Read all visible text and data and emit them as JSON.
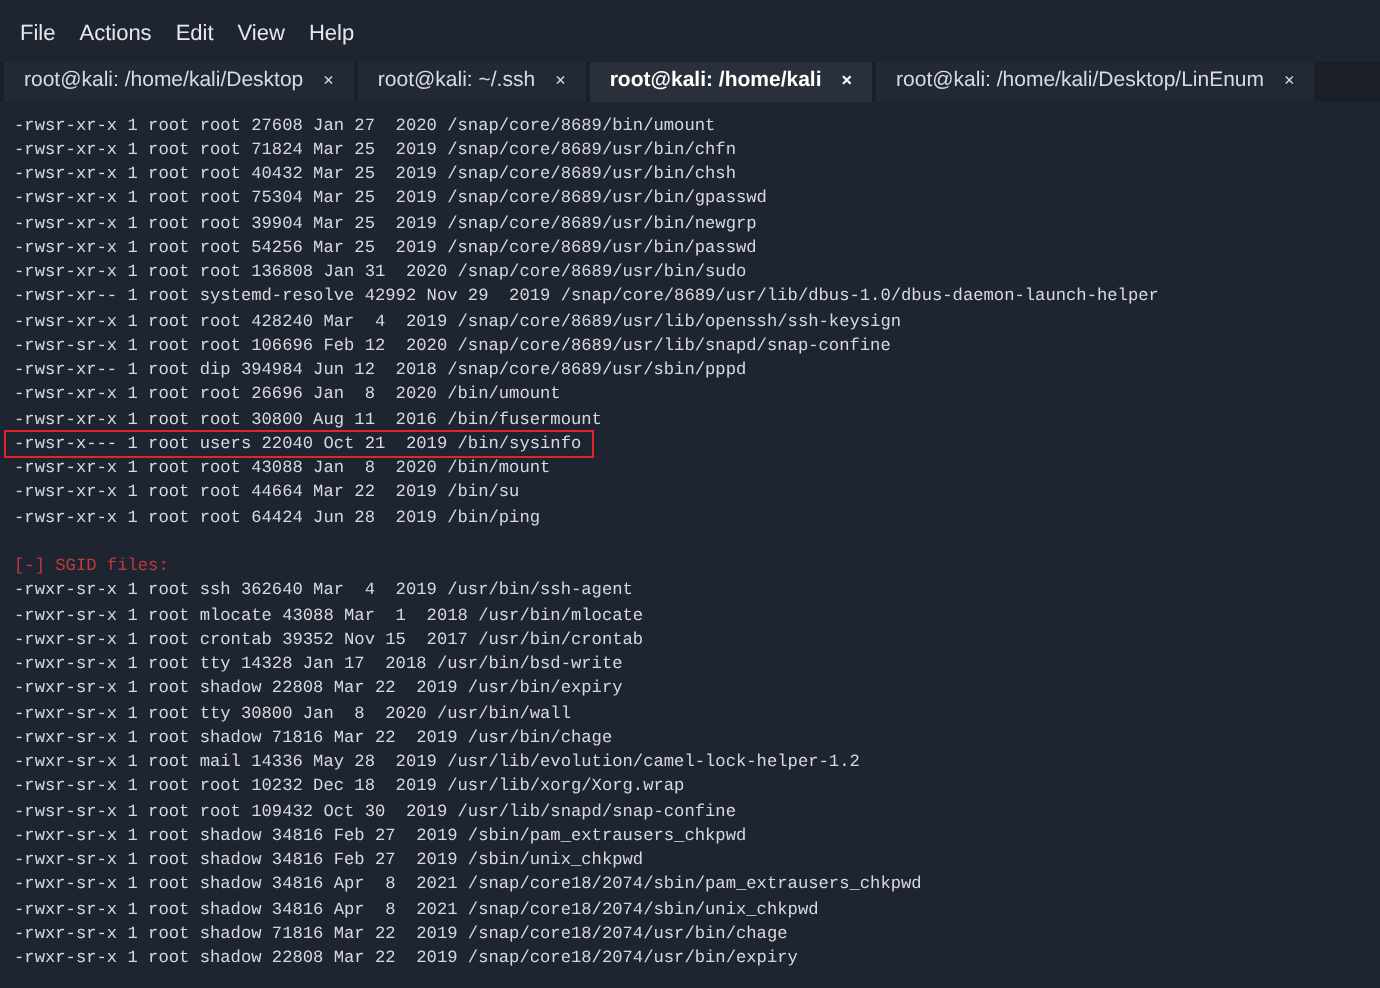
{
  "menu": [
    "File",
    "Actions",
    "Edit",
    "View",
    "Help"
  ],
  "tabs": [
    {
      "label": "root@kali: /home/kali/Desktop",
      "close": "×",
      "selected": false
    },
    {
      "label": "root@kali: ~/.ssh",
      "close": "×",
      "selected": false
    },
    {
      "label": "root@kali: /home/kali",
      "close": "×",
      "selected": true
    },
    {
      "label": "root@kali: /home/kali/Desktop/LinEnum",
      "close": "×",
      "selected": false
    }
  ],
  "lines": [
    {
      "kind": "output",
      "text": "-rwsr-xr-x 1 root root 27608 Jan 27  2020 /snap/core/8689/bin/umount",
      "highlighted": false
    },
    {
      "kind": "output",
      "text": "-rwsr-xr-x 1 root root 71824 Mar 25  2019 /snap/core/8689/usr/bin/chfn",
      "highlighted": false
    },
    {
      "kind": "output",
      "text": "-rwsr-xr-x 1 root root 40432 Mar 25  2019 /snap/core/8689/usr/bin/chsh",
      "highlighted": false
    },
    {
      "kind": "output",
      "text": "-rwsr-xr-x 1 root root 75304 Mar 25  2019 /snap/core/8689/usr/bin/gpasswd",
      "highlighted": false
    },
    {
      "kind": "output",
      "text": "-rwsr-xr-x 1 root root 39904 Mar 25  2019 /snap/core/8689/usr/bin/newgrp",
      "highlighted": false
    },
    {
      "kind": "output",
      "text": "-rwsr-xr-x 1 root root 54256 Mar 25  2019 /snap/core/8689/usr/bin/passwd",
      "highlighted": false
    },
    {
      "kind": "output",
      "text": "-rwsr-xr-x 1 root root 136808 Jan 31  2020 /snap/core/8689/usr/bin/sudo",
      "highlighted": false
    },
    {
      "kind": "output",
      "text": "-rwsr-xr-- 1 root systemd-resolve 42992 Nov 29  2019 /snap/core/8689/usr/lib/dbus-1.0/dbus-daemon-launch-helper",
      "highlighted": false
    },
    {
      "kind": "output",
      "text": "-rwsr-xr-x 1 root root 428240 Mar  4  2019 /snap/core/8689/usr/lib/openssh/ssh-keysign",
      "highlighted": false
    },
    {
      "kind": "output",
      "text": "-rwsr-sr-x 1 root root 106696 Feb 12  2020 /snap/core/8689/usr/lib/snapd/snap-confine",
      "highlighted": false
    },
    {
      "kind": "output",
      "text": "-rwsr-xr-- 1 root dip 394984 Jun 12  2018 /snap/core/8689/usr/sbin/pppd",
      "highlighted": false
    },
    {
      "kind": "output",
      "text": "-rwsr-xr-x 1 root root 26696 Jan  8  2020 /bin/umount",
      "highlighted": false
    },
    {
      "kind": "output",
      "text": "-rwsr-xr-x 1 root root 30800 Aug 11  2016 /bin/fusermount",
      "highlighted": false
    },
    {
      "kind": "output",
      "text": "-rwsr-x--- 1 root users 22040 Oct 21  2019 /bin/sysinfo",
      "highlighted": true
    },
    {
      "kind": "output",
      "text": "-rwsr-xr-x 1 root root 43088 Jan  8  2020 /bin/mount",
      "highlighted": false
    },
    {
      "kind": "output",
      "text": "-rwsr-xr-x 1 root root 44664 Mar 22  2019 /bin/su",
      "highlighted": false
    },
    {
      "kind": "output",
      "text": "-rwsr-xr-x 1 root root 64424 Jun 28  2019 /bin/ping",
      "highlighted": false
    },
    {
      "kind": "blank"
    },
    {
      "kind": "header",
      "text": "[-] SGID files:",
      "highlighted": false
    },
    {
      "kind": "output",
      "text": "-rwxr-sr-x 1 root ssh 362640 Mar  4  2019 /usr/bin/ssh-agent",
      "highlighted": false
    },
    {
      "kind": "output",
      "text": "-rwxr-sr-x 1 root mlocate 43088 Mar  1  2018 /usr/bin/mlocate",
      "highlighted": false
    },
    {
      "kind": "output",
      "text": "-rwxr-sr-x 1 root crontab 39352 Nov 15  2017 /usr/bin/crontab",
      "highlighted": false
    },
    {
      "kind": "output",
      "text": "-rwxr-sr-x 1 root tty 14328 Jan 17  2018 /usr/bin/bsd-write",
      "highlighted": false
    },
    {
      "kind": "output",
      "text": "-rwxr-sr-x 1 root shadow 22808 Mar 22  2019 /usr/bin/expiry",
      "highlighted": false
    },
    {
      "kind": "output",
      "text": "-rwxr-sr-x 1 root tty 30800 Jan  8  2020 /usr/bin/wall",
      "highlighted": false
    },
    {
      "kind": "output",
      "text": "-rwxr-sr-x 1 root shadow 71816 Mar 22  2019 /usr/bin/chage",
      "highlighted": false
    },
    {
      "kind": "output",
      "text": "-rwxr-sr-x 1 root mail 14336 May 28  2019 /usr/lib/evolution/camel-lock-helper-1.2",
      "highlighted": false
    },
    {
      "kind": "output",
      "text": "-rwsr-sr-x 1 root root 10232 Dec 18  2019 /usr/lib/xorg/Xorg.wrap",
      "highlighted": false
    },
    {
      "kind": "output",
      "text": "-rwsr-sr-x 1 root root 109432 Oct 30  2019 /usr/lib/snapd/snap-confine",
      "highlighted": false
    },
    {
      "kind": "output",
      "text": "-rwxr-sr-x 1 root shadow 34816 Feb 27  2019 /sbin/pam_extrausers_chkpwd",
      "highlighted": false
    },
    {
      "kind": "output",
      "text": "-rwxr-sr-x 1 root shadow 34816 Feb 27  2019 /sbin/unix_chkpwd",
      "highlighted": false
    },
    {
      "kind": "output",
      "text": "-rwxr-sr-x 1 root shadow 34816 Apr  8  2021 /snap/core18/2074/sbin/pam_extrausers_chkpwd",
      "highlighted": false
    },
    {
      "kind": "output",
      "text": "-rwxr-sr-x 1 root shadow 34816 Apr  8  2021 /snap/core18/2074/sbin/unix_chkpwd",
      "highlighted": false
    },
    {
      "kind": "output",
      "text": "-rwxr-sr-x 1 root shadow 71816 Mar 22  2019 /snap/core18/2074/usr/bin/chage",
      "highlighted": false
    },
    {
      "kind": "output",
      "text": "-rwxr-sr-x 1 root shadow 22808 Mar 22  2019 /snap/core18/2074/usr/bin/expiry",
      "highlighted": false
    }
  ]
}
